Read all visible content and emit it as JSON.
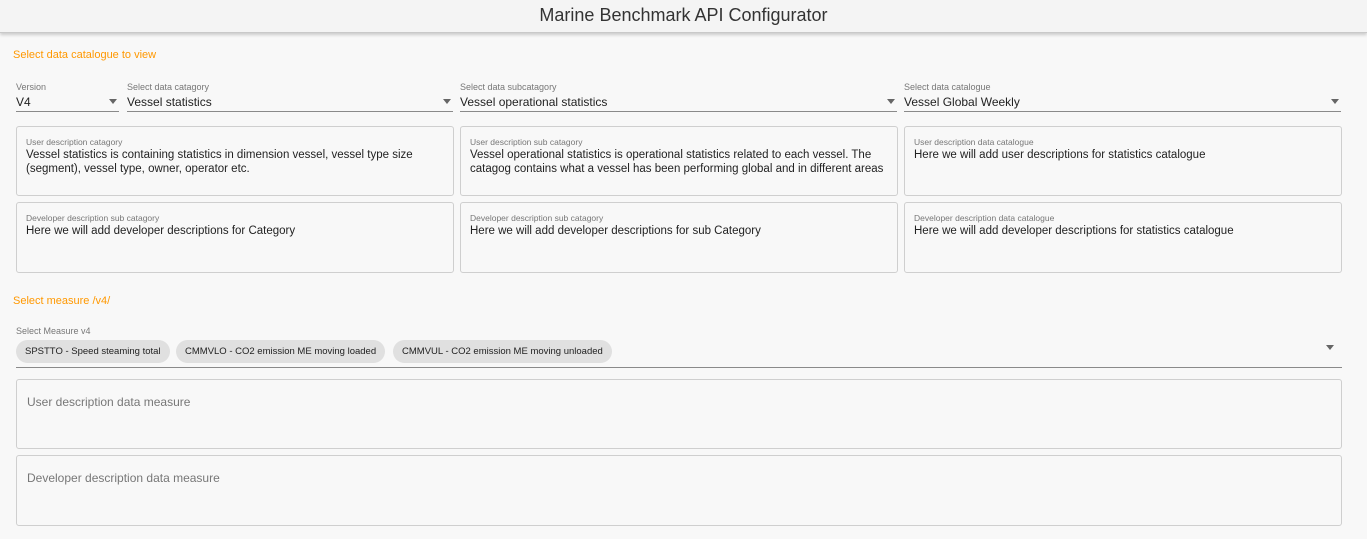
{
  "app": {
    "title": "Marine Benchmark API Configurator"
  },
  "catalogue_section": {
    "label": "Select data catalogue to view"
  },
  "selects": {
    "version": {
      "label": "Version",
      "value": "V4"
    },
    "category": {
      "label": "Select data catagory",
      "value": "Vessel statistics"
    },
    "subcategory": {
      "label": "Select data subcatagory",
      "value": "Vessel operational statistics"
    },
    "catalogue": {
      "label": "Select data catalogue",
      "value": "Vessel Global Weekly"
    }
  },
  "descriptions": {
    "user_category": {
      "label": "User description catagory",
      "text": "Vessel statistics is containing statistics in dimension vessel, vessel type size (segment), vessel type, owner, operator etc."
    },
    "user_subcategory": {
      "label": "User description sub catagory",
      "text": "Vessel operational statistics is operational statistics related to each vessel. The catagog contains what a vessel has been performing global and in different areas"
    },
    "user_catalogue": {
      "label": "User description data catalogue",
      "text": "Here we will add user descriptions for statistics catalogue"
    },
    "dev_category": {
      "label": "Developer description sub catagory",
      "text": "Here we will add developer descriptions for Category"
    },
    "dev_subcategory": {
      "label": "Developer description sub catagory",
      "text": "Here we will add developer descriptions for sub Category"
    },
    "dev_catalogue": {
      "label": "Developer description data catalogue",
      "text": "Here we will add developer descriptions for statistics catalogue"
    }
  },
  "measure_section": {
    "label": "Select measure /v4/"
  },
  "measure_select": {
    "label": "Select Measure v4",
    "chips": [
      "SPSTTO - Speed steaming total",
      "CMMVLO - CO2 emission ME moving loaded",
      "CMMVUL - CO2 emission ME moving unloaded"
    ]
  },
  "measure_descriptions": {
    "user_placeholder": "User description data measure",
    "dev_placeholder": "Developer description data measure"
  },
  "icons": {
    "dropdown": "arrow-drop-down-icon"
  }
}
